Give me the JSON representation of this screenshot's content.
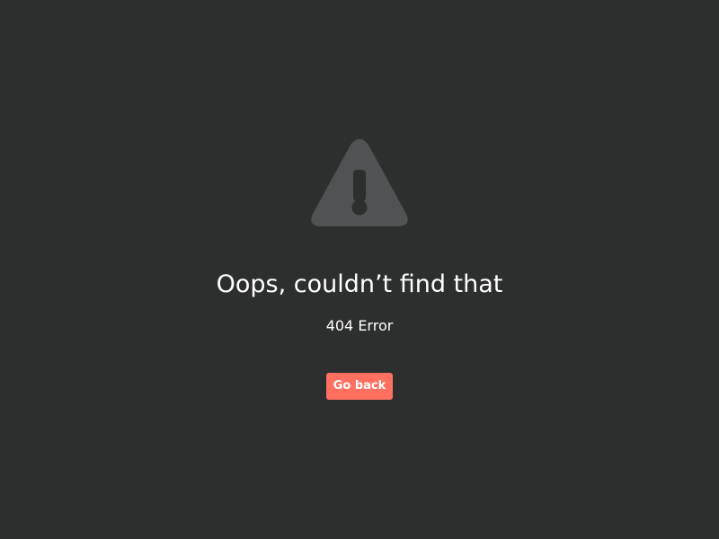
{
  "colors": {
    "background": "#2d2e2e",
    "icon": "#515254",
    "icon_glyph": "#2d2e2e",
    "text": "#ffffff",
    "button_bg": "#ff7061",
    "button_text": "#ffffff"
  },
  "icon": {
    "name": "warning-triangle-icon"
  },
  "error": {
    "title": "Oops, couldn’t find that",
    "code": "404 Error"
  },
  "actions": {
    "back_label": "Go back"
  }
}
